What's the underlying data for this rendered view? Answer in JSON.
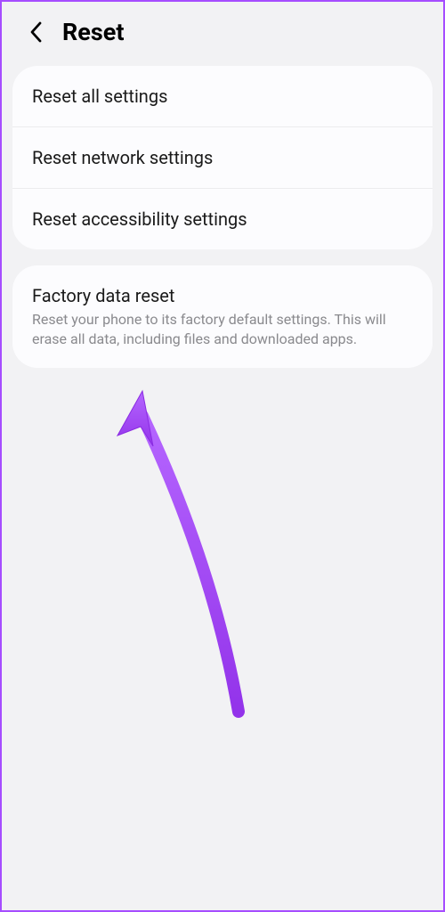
{
  "header": {
    "title": "Reset"
  },
  "group1": {
    "items": [
      {
        "title": "Reset all settings"
      },
      {
        "title": "Reset network settings"
      },
      {
        "title": "Reset accessibility settings"
      }
    ]
  },
  "group2": {
    "items": [
      {
        "title": "Factory data reset",
        "desc": "Reset your phone to its factory default settings. This will erase all data, including files and downloaded apps."
      }
    ]
  },
  "annotation": {
    "arrow_color": "#a64dff"
  }
}
